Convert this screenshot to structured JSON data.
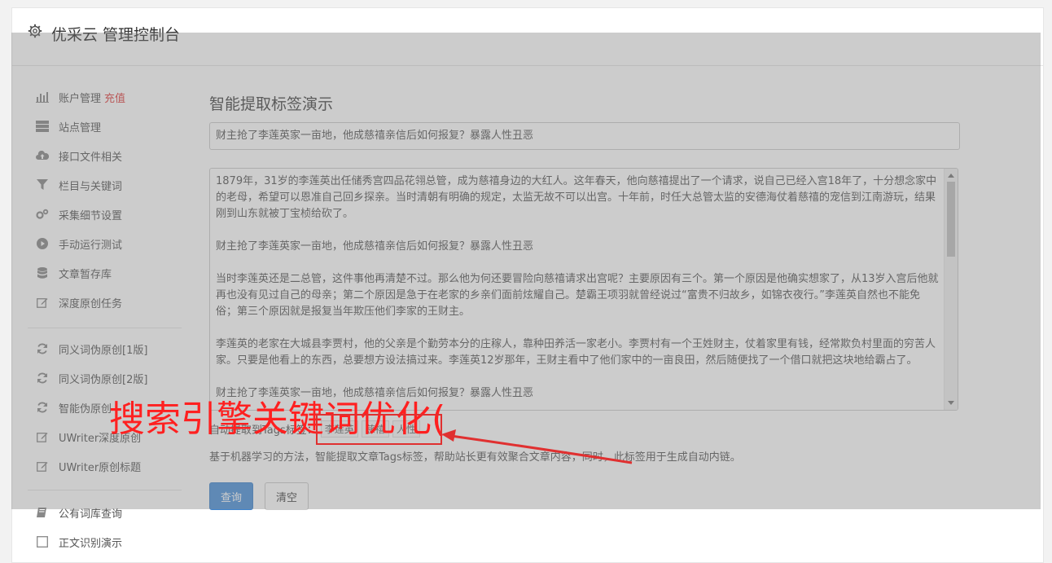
{
  "header": {
    "title": "优采云 管理控制台"
  },
  "sidebar": {
    "items": [
      {
        "label": "账户管理",
        "extra": "充值",
        "icon": "bar-chart-icon"
      },
      {
        "label": "站点管理",
        "icon": "server-icon"
      },
      {
        "label": "接口文件相关",
        "icon": "cloud-upload-icon"
      },
      {
        "label": "栏目与关键词",
        "icon": "filter-icon"
      },
      {
        "label": "采集细节设置",
        "icon": "gears-icon"
      },
      {
        "label": "手动运行测试",
        "icon": "play-circle-icon"
      },
      {
        "label": "文章暂存库",
        "icon": "database-icon"
      },
      {
        "label": "深度原创任务",
        "icon": "edit-icon"
      },
      {
        "label": "同义词伪原创[1版]",
        "icon": "refresh-icon"
      },
      {
        "label": "同义词伪原创[2版]",
        "icon": "refresh-icon"
      },
      {
        "label": "智能伪原创",
        "icon": "refresh-icon"
      },
      {
        "label": "UWriter深度原创",
        "icon": "edit-icon"
      },
      {
        "label": "UWriter原创标题",
        "icon": "edit-icon"
      },
      {
        "label": "公有词库查询",
        "icon": "book-icon"
      },
      {
        "label": "正文识别演示",
        "icon": "square-icon"
      }
    ]
  },
  "main": {
    "title": "智能提取标签演示",
    "title_value": "财主抢了李莲英家一亩地，他成慈禧亲信后如何报复？暴露人性丑恶",
    "content_paragraphs": [
      "1879年，31岁的李莲英出任储秀宫四品花翎总管，成为慈禧身边的大红人。这年春天，他向慈禧提出了一个请求，说自己已经入宫18年了，十分想念家中的老母，希望可以恩准自己回乡探亲。当时清朝有明确的规定，太监无故不可以出宫。十年前，时任大总管太监的安德海仗着慈禧的宠信到江南游玩，结果刚到山东就被丁宝桢给砍了。",
      "财主抢了李莲英家一亩地，他成慈禧亲信后如何报复？暴露人性丑恶",
      "当时李莲英还是二总管，这件事他再清楚不过。那么他为何还要冒险向慈禧请求出宫呢？主要原因有三个。第一个原因是他确实想家了，从13岁入宫后他就再也没有见过自己的母亲；第二个原因是急于在老家的乡亲们面前炫耀自己。楚霸王项羽就曾经说过“富贵不归故乡，如锦衣夜行。”李莲英自然也不能免俗；第三个原因就是报复当年欺压他们李家的王财主。",
      "李莲英的老家在大城县李贾村，他的父亲是个勤劳本分的庄稼人，靠种田养活一家老小。李贾村有一个王姓财主，仗着家里有钱，经常欺负村里面的穷苦人家。只要是他看上的东西，总要想方设法搞过来。李莲英12岁那年，王财主看中了他们家中的一亩良田，然后随便找了一个借口就把这块地给霸占了。",
      "财主抢了李莲英家一亩地，他成慈禧亲信后如何报复？暴露人性丑恶"
    ],
    "tags_label": "自动提取到Tags标签：",
    "tags": [
      "李莲英",
      "慈禧",
      "人性"
    ],
    "description": "基于机器学习的方法，智能提取文章Tags标签，帮助站长更有效聚合文章内容，同时，此标签用于生成自动内链。",
    "query_button": "查询",
    "clear_button": "清空"
  },
  "annotation": {
    "text": "搜索引擎关键词优化(",
    "color": "#ff2020"
  }
}
